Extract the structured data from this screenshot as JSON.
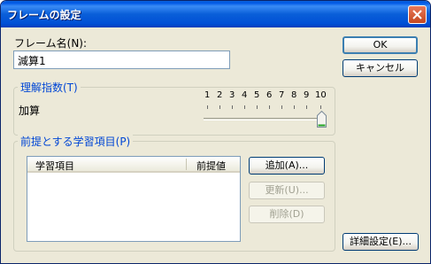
{
  "window": {
    "title": "フレームの設定"
  },
  "frame_name": {
    "label": "フレーム名(N):",
    "value": "減算1"
  },
  "buttons": {
    "ok": "OK",
    "cancel": "キャンセル",
    "add": "追加(A)...",
    "update": "更新(U)...",
    "delete": "削除(D)",
    "advanced": "詳細設定(E)..."
  },
  "understanding_group": {
    "title": "理解指数(T)",
    "row_label": "加算",
    "ticks": [
      "1",
      "2",
      "3",
      "4",
      "5",
      "6",
      "7",
      "8",
      "9",
      "10"
    ],
    "slider_value": 10
  },
  "prereq_group": {
    "title": "前提とする学習項目(P)",
    "columns": [
      "学習項目",
      "前提値"
    ],
    "rows": []
  }
}
